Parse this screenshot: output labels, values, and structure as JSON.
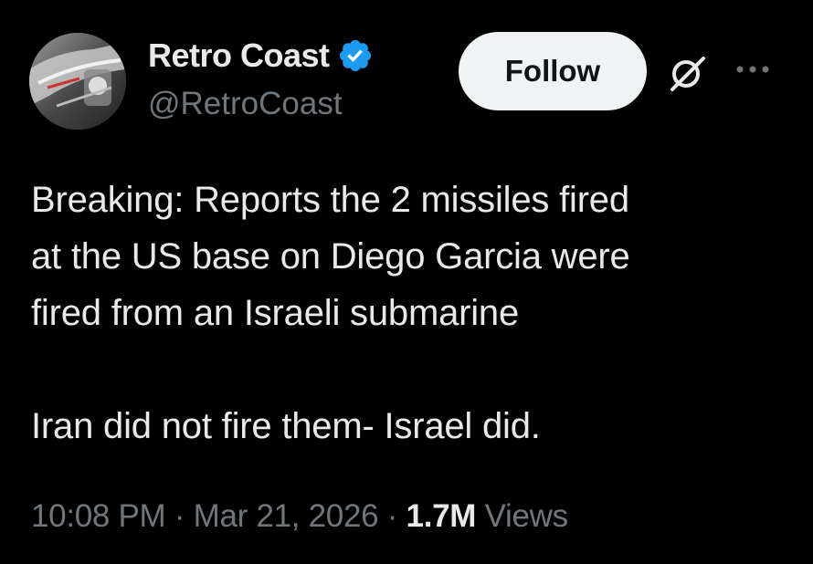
{
  "author": {
    "display_name": "Retro Coast",
    "handle": "@RetroCoast",
    "verified": true,
    "verified_color": "#1d9bf0",
    "avatar_icon": "classic-car-avatar"
  },
  "actions": {
    "follow_label": "Follow",
    "grok_icon": "grok-icon",
    "more_icon": "more-icon"
  },
  "tweet": {
    "lines": [
      "Breaking: Reports the 2 missiles fired",
      "at the US base on Diego Garcia were",
      "fired from an Israeli submarine"
    ],
    "second_paragraph": "Iran did not fire them- Israel did."
  },
  "meta": {
    "time": "10:08 PM",
    "separator": "·",
    "date": "Mar 21, 2026",
    "views_count": "1.7M",
    "views_label": "Views"
  },
  "colors": {
    "background": "#000000",
    "text_primary": "#e7e9ea",
    "text_secondary": "#71767b",
    "button_bg": "#eff3f4"
  }
}
